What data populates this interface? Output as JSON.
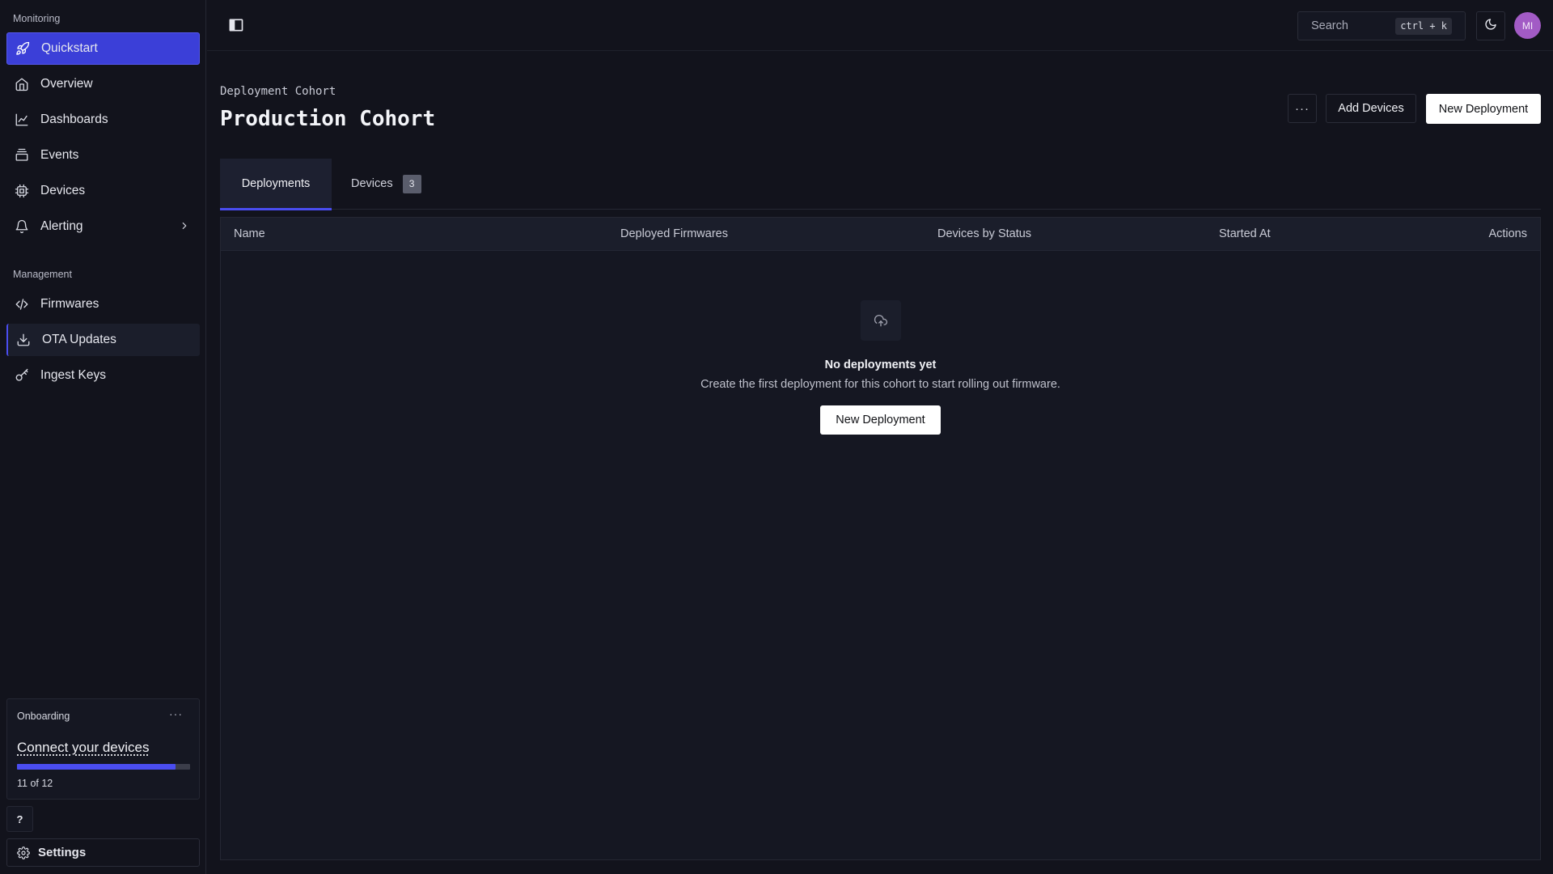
{
  "sidebar": {
    "monitoring_label": "Monitoring",
    "management_label": "Management",
    "items": [
      {
        "label": "Quickstart",
        "icon": "rocket-icon"
      },
      {
        "label": "Overview",
        "icon": "home-icon"
      },
      {
        "label": "Dashboards",
        "icon": "chart-line-icon"
      },
      {
        "label": "Events",
        "icon": "layers-icon"
      },
      {
        "label": "Devices",
        "icon": "chip-icon"
      },
      {
        "label": "Alerting",
        "icon": "bell-icon"
      }
    ],
    "management_items": [
      {
        "label": "Firmwares",
        "icon": "code-icon"
      },
      {
        "label": "OTA Updates",
        "icon": "download-icon"
      },
      {
        "label": "Ingest Keys",
        "icon": "key-icon"
      }
    ],
    "onboarding": {
      "title": "Onboarding",
      "link": "Connect your devices",
      "progress": "11 of 12",
      "progress_fraction": 0.917
    },
    "help_label": "?",
    "settings_label": "Settings"
  },
  "topbar": {
    "search_label": "Search",
    "search_shortcut": "ctrl + k",
    "avatar_initials": "MI"
  },
  "page": {
    "breadcrumb": "Deployment Cohort",
    "title": "Production Cohort",
    "more_label": "···",
    "add_devices_label": "Add Devices",
    "new_deployment_label": "New Deployment"
  },
  "tabs": {
    "deployments": "Deployments",
    "devices": "Devices",
    "devices_count": "3"
  },
  "table": {
    "columns": [
      "Name",
      "Deployed Firmwares",
      "Devices by Status",
      "Started At",
      "Actions"
    ],
    "empty_title": "No deployments yet",
    "empty_subtitle": "Create the first deployment for this cohort to start rolling out firmware.",
    "empty_button": "New Deployment"
  },
  "colors": {
    "accent": "#4a4df0",
    "background": "#12131c",
    "avatar": "#a25bc5"
  }
}
